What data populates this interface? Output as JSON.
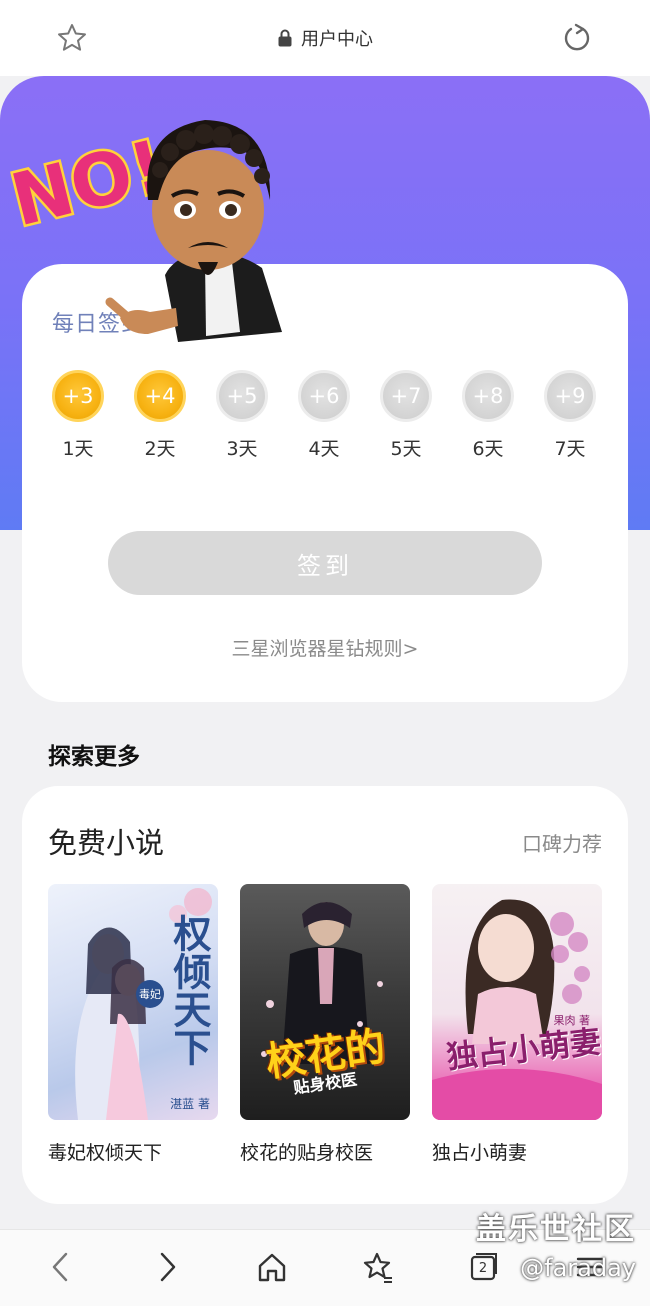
{
  "topbar": {
    "title": "用户中心"
  },
  "checkin": {
    "title": "每日签到",
    "days": [
      {
        "points": "+3",
        "label": "1天",
        "claimed": true
      },
      {
        "points": "+4",
        "label": "2天",
        "claimed": true
      },
      {
        "points": "+5",
        "label": "3天",
        "claimed": false
      },
      {
        "points": "+6",
        "label": "4天",
        "claimed": false
      },
      {
        "points": "+7",
        "label": "5天",
        "claimed": false
      },
      {
        "points": "+8",
        "label": "6天",
        "claimed": false
      },
      {
        "points": "+9",
        "label": "7天",
        "claimed": false
      }
    ],
    "button_label": "签到",
    "rules_link": "三星浏览器星钻规则>"
  },
  "sticker": {
    "text": "NO!"
  },
  "explore": {
    "title": "探索更多",
    "section_title": "免费小说",
    "section_tag": "口碑力荐",
    "books": [
      {
        "title": "毒妃权倾天下",
        "cover_text": "权倾天下",
        "cover_small": "毒妃",
        "author": "湛蓝 著"
      },
      {
        "title": "校花的贴身校医",
        "cover_text": "校花的",
        "cover_small": "贴身校医"
      },
      {
        "title": "独占小萌妻",
        "cover_text": "独占小萌妻",
        "cover_small": "果肉 著"
      }
    ]
  },
  "bottomnav": {
    "tab_count": "2"
  },
  "watermark": {
    "line1": "盖乐世社区",
    "line2": "@faraday"
  },
  "colors": {
    "accent_start": "#8b6ff6",
    "accent_end": "#5f7bf4",
    "coin_gold": "#f7b212",
    "coin_grey": "#d3d3d3"
  }
}
